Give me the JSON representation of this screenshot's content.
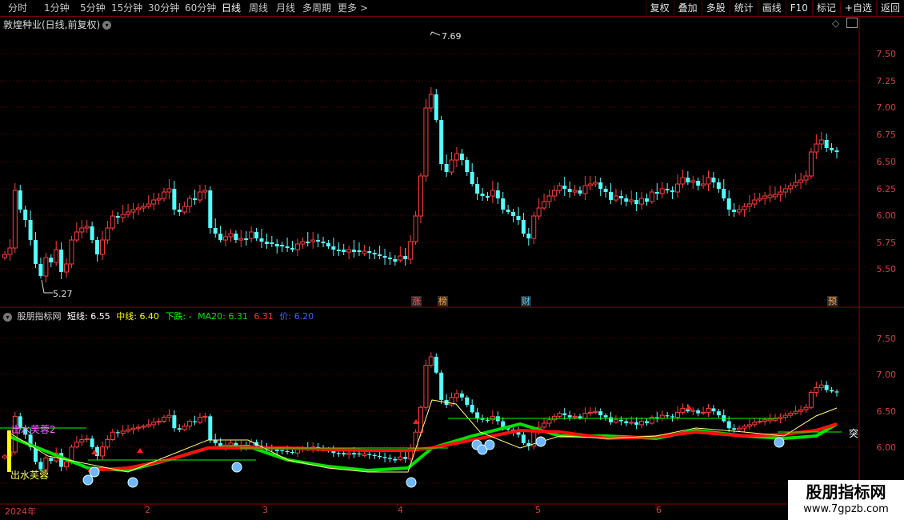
{
  "topbar": {
    "periods": [
      "分时",
      "1分钟",
      "5分钟",
      "15分钟",
      "30分钟",
      "60分钟",
      "日线",
      "周线",
      "月线",
      "多周期",
      "更多 >"
    ],
    "active_period": "日线",
    "buttons": [
      "复权",
      "叠加",
      "多股",
      "统计",
      "画线",
      "F10",
      "标记",
      "+自选",
      "返回"
    ]
  },
  "main_panel": {
    "title": "敦煌种业(日线,前复权)",
    "high_label": "7.69",
    "low_label": "5.27",
    "y_ticks": [
      "7.50",
      "7.25",
      "7.00",
      "6.75",
      "6.50",
      "6.25",
      "6.00",
      "5.75",
      "5.50"
    ],
    "badges": [
      {
        "text": "涨",
        "color": "#ff5050"
      },
      {
        "text": "榜",
        "color": "#ffa040"
      },
      {
        "text": "财",
        "color": "#50d0ff"
      },
      {
        "text": "预",
        "color": "#ffa040"
      }
    ]
  },
  "indicator_panel": {
    "name": "股朋指标网",
    "short_label": "短线:",
    "short_value": "6.55",
    "mid_label": "中线:",
    "mid_value": "6.40",
    "down_label": "下跌:",
    "down_value": "-",
    "ma20_label": "MA20:",
    "ma20_value": "6.31",
    "red_value": "6.31",
    "price_label": "价:",
    "price_value": "6.20",
    "y_ticks": [
      "7.50",
      "7.00",
      "6.50",
      "6.00"
    ],
    "annot_top": "出水芙蓉2",
    "annot_bottom": "出水芙蓉",
    "right_text": "突"
  },
  "date_axis": {
    "labels": [
      "2024年",
      "2",
      "3",
      "4",
      "5",
      "6"
    ]
  },
  "watermark": {
    "title": "股朋指标网",
    "url": "www.7gpzb.com"
  },
  "colors": {
    "up": "#ff3c3c",
    "down": "#54ffff",
    "short_line": "#ffffff",
    "mid_line": "#ffff00",
    "down_line": "#00ff00",
    "ma20": "#00e000"
  }
}
